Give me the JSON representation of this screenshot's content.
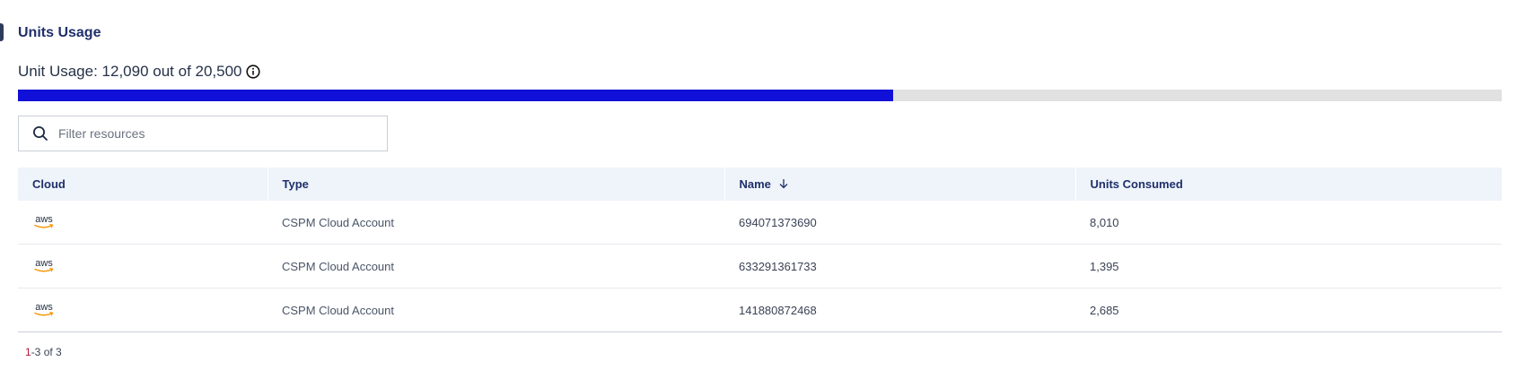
{
  "section": {
    "title": "Units Usage"
  },
  "usage": {
    "label": "Unit Usage: 12,090 out of 20,500",
    "used": 12090,
    "total": 20500,
    "fill_color": "#1010d8",
    "track_color": "#e1e1e1"
  },
  "filter": {
    "placeholder": "Filter resources",
    "value": "",
    "icon": "search-icon"
  },
  "table": {
    "columns": [
      "Cloud",
      "Type",
      "Name",
      "Units Consumed"
    ],
    "sort": {
      "column": "Name",
      "direction": "descending",
      "icon": "arrow-down-icon"
    },
    "rows": [
      {
        "cloud": "aws",
        "type": "CSPM Cloud Account",
        "name": "694071373690",
        "units": "8,010"
      },
      {
        "cloud": "aws",
        "type": "CSPM Cloud Account",
        "name": "633291361733",
        "units": "1,395"
      },
      {
        "cloud": "aws",
        "type": "CSPM Cloud Account",
        "name": "141880872468",
        "units": "2,685"
      }
    ]
  },
  "pagination": {
    "range_start": "1",
    "range_rest": "-3 of 3"
  },
  "colors": {
    "header_bg": "#eef4f9",
    "title": "#1f2f6b",
    "aws_smile": "#f79400"
  }
}
